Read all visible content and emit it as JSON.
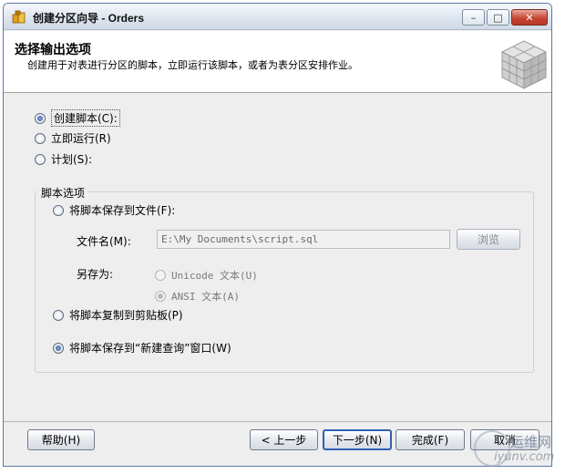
{
  "window": {
    "title": "创建分区向导 - Orders",
    "minimize_glyph": "–",
    "maximize_glyph": "□",
    "close_glyph": "✕"
  },
  "header": {
    "title": "选择输出选项",
    "description": "创建用于对表进行分区的脚本，立即运行该脚本，或者为表分区安排作业。"
  },
  "options": {
    "create_script": "创建脚本(C):",
    "run_now": "立即运行(R)",
    "schedule": "计划(S):"
  },
  "script_options": {
    "legend": "脚本选项",
    "save_to_file": "将脚本保存到文件(F):",
    "filename_label": "文件名(M):",
    "filename_value": "E:\\My Documents\\script.sql",
    "browse_button": "浏览",
    "save_as_label": "另存为:",
    "unicode_text": "Unicode 文本(U)",
    "ansi_text": "ANSI 文本(A)",
    "copy_to_clipboard": "将脚本复制到剪贴板(P)",
    "save_to_new_query": "将脚本保存到“新建查询”窗口(W)"
  },
  "buttons": {
    "help": "帮助(H)",
    "back": "< 上一步",
    "next": "下一步(N)",
    "finish": "完成(F)",
    "cancel": "取消"
  },
  "watermark": {
    "line1": "运维网",
    "line2": "iyunv.com"
  }
}
